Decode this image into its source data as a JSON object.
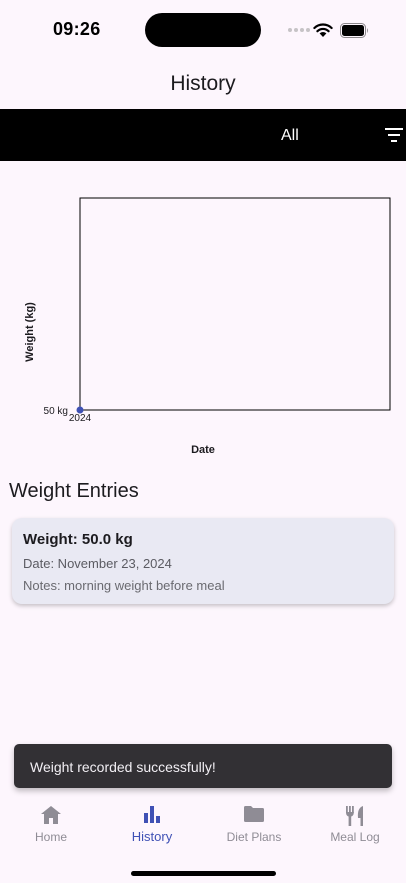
{
  "status_bar": {
    "time": "09:26"
  },
  "app_bar": {
    "title": "History"
  },
  "filter": {
    "selected": "All",
    "icon": "filter-list-icon"
  },
  "chart_data": {
    "type": "line",
    "xlabel": "Date",
    "ylabel": "Weight (kg)",
    "x_tick_labels": [
      "2024"
    ],
    "y_tick_labels": [
      "50 kg"
    ],
    "series": [
      {
        "x": [
          "2024-11-23"
        ],
        "values": [
          50.0
        ]
      }
    ],
    "grid": false,
    "colors": {
      "point": "#3f51b5",
      "axis": "#000000"
    }
  },
  "entries_section": {
    "title": "Weight Entries",
    "items": [
      {
        "weight": "Weight: 50.0 kg",
        "date": "Date: November 23, 2024",
        "notes": "Notes: morning weight before meal"
      }
    ]
  },
  "snackbar": {
    "message": "Weight recorded successfully!"
  },
  "bottom_nav": {
    "items": [
      {
        "label": "Home",
        "icon": "home-icon",
        "active": false
      },
      {
        "label": "History",
        "icon": "bar-chart-icon",
        "active": true
      },
      {
        "label": "Diet Plans",
        "icon": "folder-icon",
        "active": false
      },
      {
        "label": "Meal Log",
        "icon": "restaurant-icon",
        "active": false
      }
    ]
  },
  "colors": {
    "background": "#fdf6fd",
    "accent": "#3f51b5",
    "card": "#e9e9f3",
    "snackbar": "#323034"
  }
}
